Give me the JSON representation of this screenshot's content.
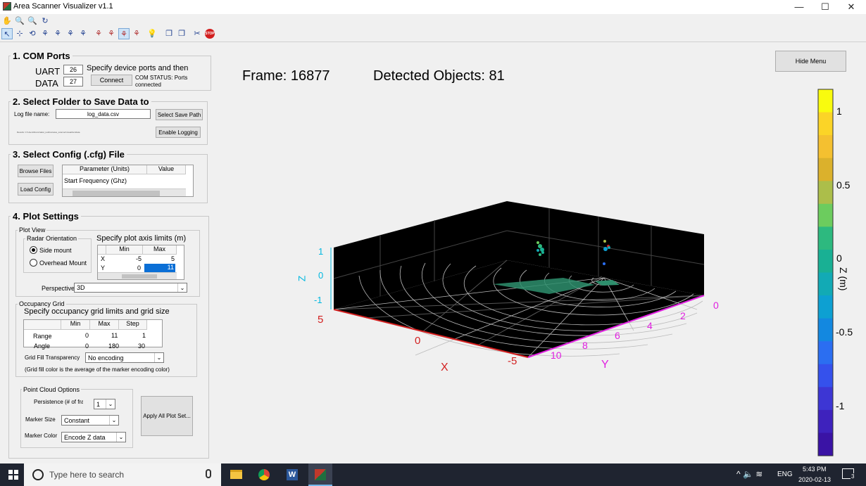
{
  "window": {
    "title": "Area Scanner Visualizer v1.1",
    "min": "—",
    "max": "☐",
    "close": "✕"
  },
  "toolbar": {
    "row1": [
      "✋",
      "🔍",
      "🔍",
      "↻"
    ],
    "row2": [
      "↖",
      "⊹",
      "⟲",
      "⚘",
      "⚘",
      "⚘",
      "⚘",
      "⚘",
      "⚘",
      "⚘",
      "⚘",
      "⚘",
      "💡",
      "❐",
      "❐",
      "✂",
      "STOP"
    ]
  },
  "com": {
    "title": "1. COM Ports",
    "uart_label": "UART",
    "uart_value": "26",
    "data_label": "DATA",
    "data_value": "27",
    "hint": "Specify device ports and then",
    "connect": "Connect",
    "status": "COM STATUS: Ports connected"
  },
  "folder": {
    "title": "2. Select Folder to Save Data to",
    "log_label": "Log file name:",
    "log_value": "log_data.csv",
    "select_path": "Select Save Path",
    "enable_logging": "Enable Logging",
    "path_text": "Results: C:\\Users\\Docs\\radar_toolbox\\area_scanner\\visualizer\\data"
  },
  "config": {
    "title": "3. Select Config (.cfg) File",
    "browse": "Browse Files",
    "load": "Load Config",
    "col1": "Parameter (Units)",
    "col2": "Value",
    "row1": "Start Frequency (Ghz)"
  },
  "plot": {
    "title": "4. Plot Settings",
    "view_title": "Plot View",
    "radar_title": "Radar Orientation",
    "side": "Side mount",
    "overhead": "Overhead Mount",
    "axis_title": "Specify plot axis limits (m)",
    "min": "Min",
    "max": "Max",
    "x": "X",
    "y": "Y",
    "x_min": "-5",
    "x_max": "5",
    "y_min": "0",
    "y_max": "11",
    "perspective_label": "Perspective",
    "perspective_value": "3D",
    "grid_title": "Occupancy Grid",
    "grid_spec": "Specify occupancy grid limits and grid size",
    "step": "Step",
    "range": "Range",
    "angle": "Angle",
    "range_min": "0",
    "range_max": "11",
    "range_step": "1",
    "angle_min": "0",
    "angle_max": "180",
    "angle_step": "30",
    "fill_label": "Grid Fill Transparency",
    "fill_value": "No encoding",
    "fill_note": "(Grid fill color is the average of the marker encoding color)",
    "pc_title": "Point Cloud Options",
    "persistence_label": "Persistence (# of frames)",
    "persistence_value": "1",
    "marker_size_label": "Marker Size",
    "marker_size_value": "Constant",
    "marker_color_label": "Marker Color",
    "marker_color_value": "Encode Z data",
    "apply": "Apply All Plot Set..."
  },
  "main": {
    "hide_menu": "Hide Menu",
    "frame": "Frame: 16877",
    "detected": "Detected Objects: 81"
  },
  "axes": {
    "z_label": "Z",
    "x_label": "X",
    "y_label": "Y",
    "z_ticks": [
      "1",
      "0",
      "-1"
    ],
    "x_ticks": [
      "5",
      "0",
      "-5"
    ],
    "y_ticks": [
      "0",
      "2",
      "4",
      "6",
      "8",
      "10"
    ],
    "colorbar_label": "Z (m)",
    "colorbar_ticks": [
      "1",
      "0.5",
      "0",
      "-0.5",
      "-1"
    ],
    "colorbar_colors": [
      "#f9fb0e",
      "#fbd427",
      "#f4c030",
      "#dbb12c",
      "#acbe4a",
      "#6ccc5e",
      "#2db97f",
      "#19b094",
      "#12aab5",
      "#0da0d2",
      "#1388e0",
      "#2b6ef1",
      "#3551ec",
      "#3d36d4",
      "#3e22bd",
      "#3a13a5"
    ]
  },
  "taskbar": {
    "search": "Type here to search",
    "lang": "ENG",
    "time": "5:43 PM",
    "date": "2020-02-13",
    "notif": "3"
  }
}
